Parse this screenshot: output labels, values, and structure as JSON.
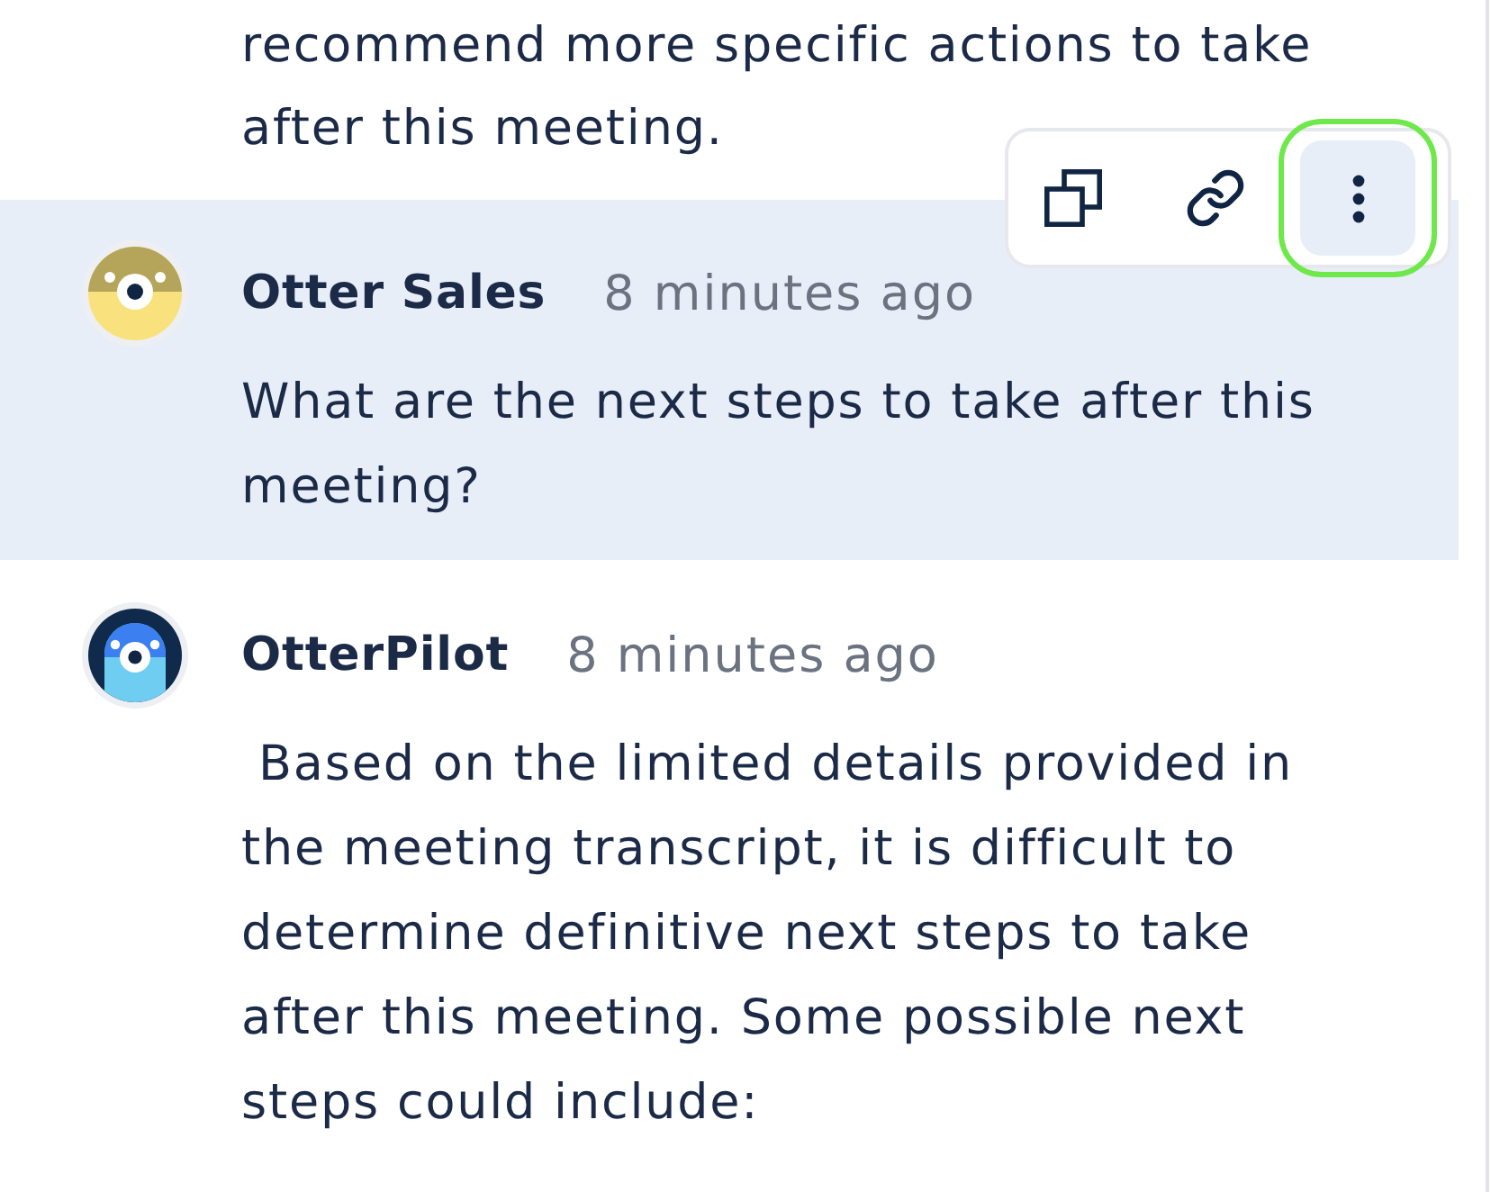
{
  "intro_text": "recommend more specific actions to take after this meeting.",
  "messages": [
    {
      "kind": "sales",
      "author": "Otter Sales",
      "time": "8 minutes ago",
      "text": "What are the next steps to take after this meeting?",
      "highlighted": true
    },
    {
      "kind": "pilot",
      "author": "OtterPilot",
      "time": "8 minutes ago",
      "text": " Based on the limited details provided in the meeting transcript, it is difficult to determine definitive next steps to take after this meeting. Some possible next steps could include:",
      "highlighted": false
    }
  ],
  "message_actions": [
    {
      "kind": "copy",
      "active": false
    },
    {
      "kind": "link",
      "active": false
    },
    {
      "kind": "more",
      "active": true
    }
  ]
}
